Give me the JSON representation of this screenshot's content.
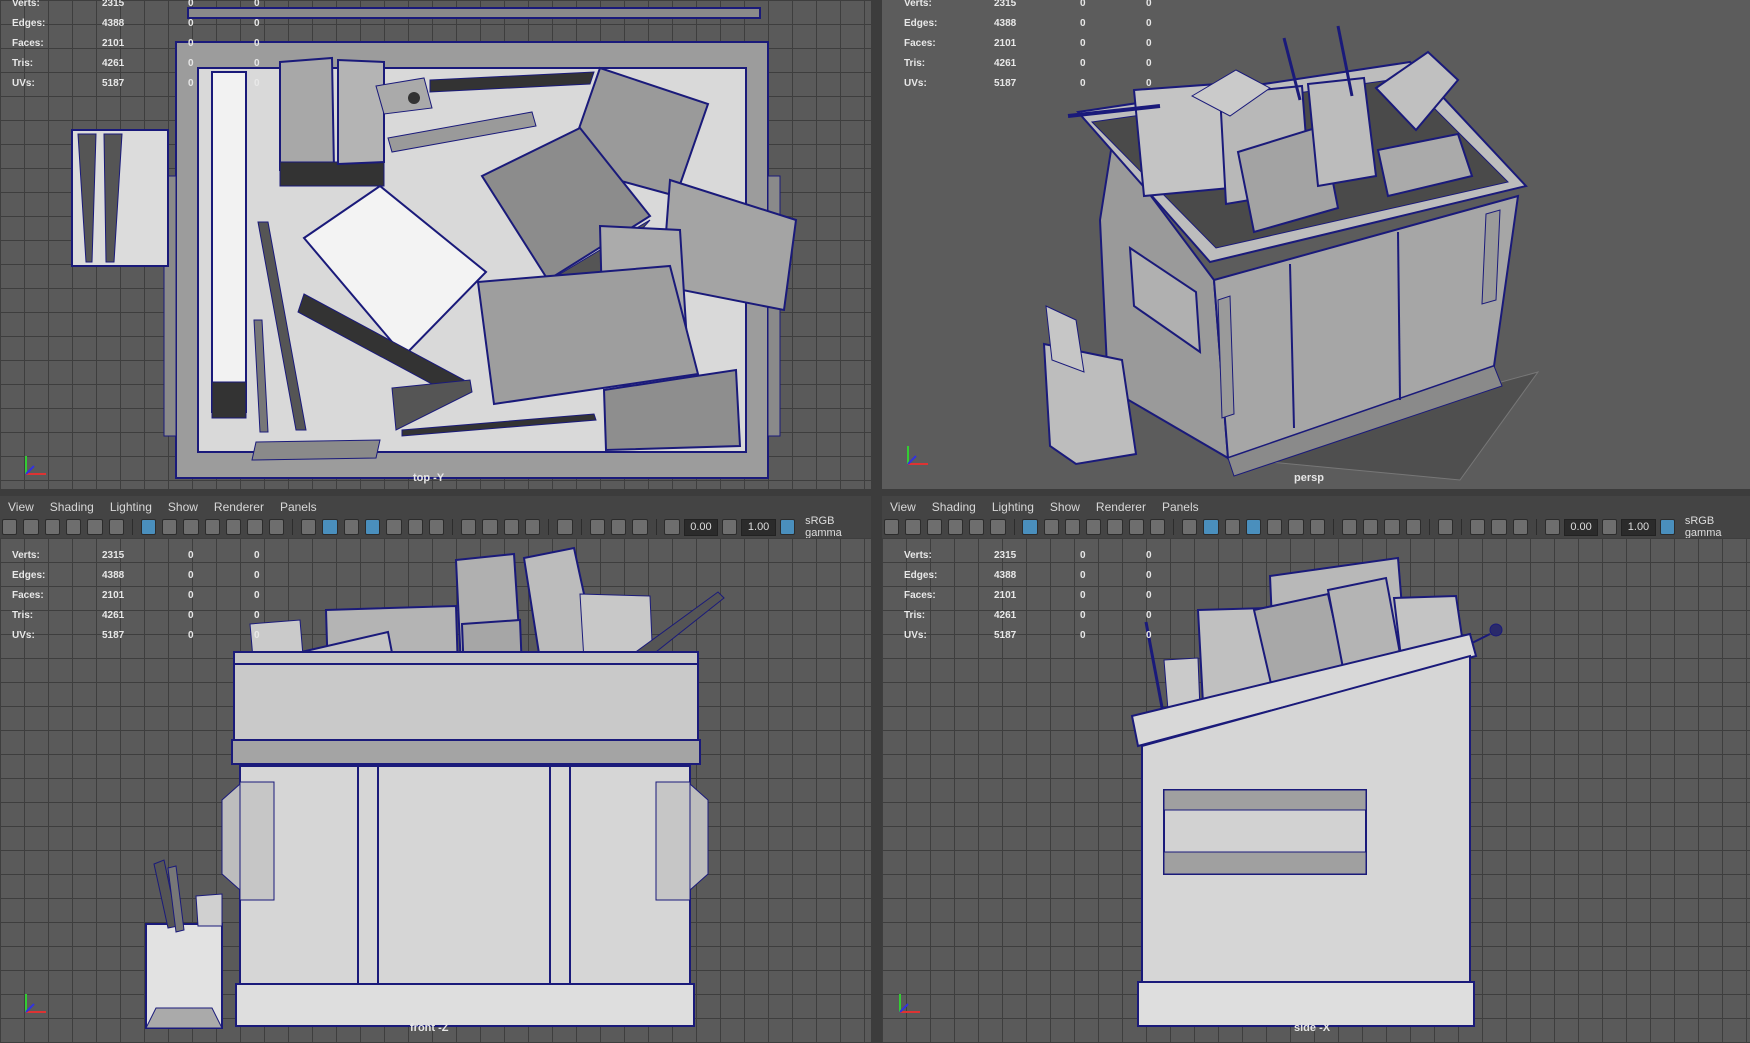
{
  "panel_menu": [
    "View",
    "Shading",
    "Lighting",
    "Show",
    "Renderer",
    "Panels"
  ],
  "toolbar": {
    "exposure": "0.00",
    "gamma": "1.00",
    "color_space": "sRGB gamma"
  },
  "hud": {
    "labels": [
      "Verts:",
      "Edges:",
      "Faces:",
      "Tris:",
      "UVs:"
    ],
    "values": [
      "2315",
      "4388",
      "2101",
      "4261",
      "5187"
    ],
    "zero": "0"
  },
  "viewports": {
    "top": "top -Y",
    "persp": "persp",
    "front": "front -Z",
    "side": "side -X"
  },
  "colors": {
    "viewport_bg": "#5a5a5a",
    "grid_line": "#3e3e3e",
    "wire": "#1a1a7a",
    "shaded": "#9a9a9a",
    "highlight": "#e8e8e8",
    "toolbar_bg": "#444444",
    "active_icon": "#4a8fbd"
  }
}
